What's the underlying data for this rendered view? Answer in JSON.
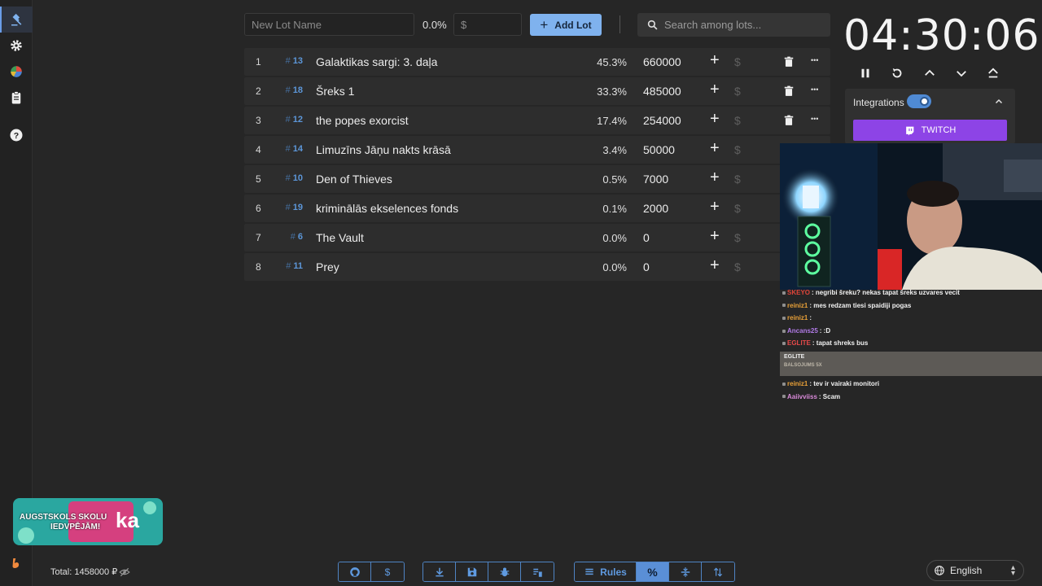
{
  "toolbar": {
    "new_lot_placeholder": "New Lot Name",
    "percent_value": "0.0%",
    "amount_placeholder": "$",
    "add_lot_label": "Add Lot",
    "search_placeholder": "Search among lots..."
  },
  "lots": [
    {
      "pos": "1",
      "id": "13",
      "name": "Galaktikas sargi: 3. daļa",
      "percent": "45.3%",
      "amount": "660000"
    },
    {
      "pos": "2",
      "id": "18",
      "name": "Šreks 1",
      "percent": "33.3%",
      "amount": "485000"
    },
    {
      "pos": "3",
      "id": "12",
      "name": "the popes exorcist",
      "percent": "17.4%",
      "amount": "254000"
    },
    {
      "pos": "4",
      "id": "14",
      "name": "Limuzīns Jāņu nakts krāsā",
      "percent": "3.4%",
      "amount": "50000"
    },
    {
      "pos": "5",
      "id": "10",
      "name": "Den of Thieves",
      "percent": "0.5%",
      "amount": "7000"
    },
    {
      "pos": "6",
      "id": "19",
      "name": "kriminālās ekselences fonds",
      "percent": "0.1%",
      "amount": "2000"
    },
    {
      "pos": "7",
      "id": "6",
      "name": "The Vault",
      "percent": "0.0%",
      "amount": "0"
    },
    {
      "pos": "8",
      "id": "11",
      "name": "Prey",
      "percent": "0.0%",
      "amount": "0"
    }
  ],
  "lot_row_symbols": {
    "hash": "#",
    "add": "+",
    "donate": "$",
    "more": "•••"
  },
  "timer": {
    "value": "04:30:06"
  },
  "integrations": {
    "label": "Integrations",
    "twitch_label": "TWITCH",
    "enabled": true
  },
  "chat": {
    "messages": [
      {
        "user": "SKEYO",
        "text": ": negribi šreku? nekas tapat šreks uzvares vecit",
        "color": "#e0453a"
      },
      {
        "user": "reiniz1",
        "text": ": mes redzam tiesi spaidiji pogas",
        "color": "#e8a038"
      },
      {
        "user": "reiniz1",
        "text": ":",
        "color": "#e8a038"
      },
      {
        "user": "Ancans25",
        "text": ": :D",
        "color": "#b07ae6"
      },
      {
        "user": "EGLITE",
        "text": ": tapat shreks bus",
        "color": "#e84a4a"
      }
    ],
    "highlight": {
      "user": "EGLITE",
      "text": "BALSOJUMS 5X"
    },
    "messages_after": [
      {
        "user": "reiniz1",
        "text": ": tev ir vairaki monitori",
        "color": "#e8a038"
      },
      {
        "user": "Aaiivviiss",
        "text": ": Scam",
        "color": "#d98ad9"
      }
    ]
  },
  "banner": {
    "line1": "AUGSTSKOLS SKOLU",
    "line2": "IEDVPĒJĀM!",
    "logo_text": "ka"
  },
  "footer": {
    "total_label": "Total: 1458000 ₽",
    "rules_label": "Rules",
    "percent_symbol": "%",
    "donate_symbol": "$",
    "language": "English"
  },
  "colors": {
    "accent": "#7fb2ee",
    "twitch": "#8d44e6",
    "background": "#262626",
    "row": "#2d2d2d"
  }
}
